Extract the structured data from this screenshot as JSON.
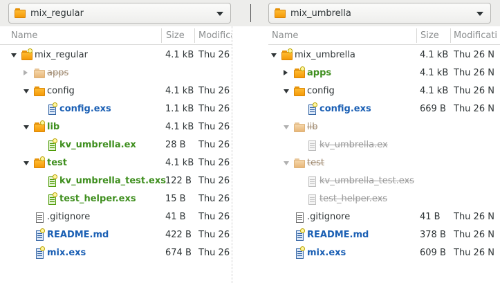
{
  "colors": {
    "modified_blue": "#1a5fb4",
    "added_green": "#3f8f1f",
    "missing_gray": "#9a9a9a",
    "folder_orange": "#f49a08"
  },
  "left": {
    "picker": {
      "label": "mix_regular",
      "icon": "folder-icon"
    },
    "columns": {
      "name": "Name",
      "size": "Size",
      "modified": "Modificati"
    },
    "rows": [
      {
        "name": "mix_regular",
        "size": "4.1 kB",
        "modified": "Thu 26",
        "icon": "folder-icon",
        "expander": "down",
        "depth": 0,
        "style": "normal"
      },
      {
        "name": "apps",
        "size": "",
        "modified": "",
        "icon": "folder-icon",
        "expander": "right",
        "depth": 1,
        "style": "ghost"
      },
      {
        "name": "config",
        "size": "4.1 kB",
        "modified": "Thu 26",
        "icon": "folder-icon",
        "expander": "down",
        "depth": 1,
        "style": "normal"
      },
      {
        "name": "config.exs",
        "size": "1.1 kB",
        "modified": "Thu 26",
        "icon": "file-icon",
        "expander": "",
        "depth": 2,
        "style": "blue"
      },
      {
        "name": "lib",
        "size": "4.1 kB",
        "modified": "Thu 26",
        "icon": "folder-icon",
        "expander": "down",
        "depth": 1,
        "style": "green"
      },
      {
        "name": "kv_umbrella.ex",
        "size": "28 B",
        "modified": "Thu 26",
        "icon": "file-icon",
        "expander": "",
        "depth": 2,
        "style": "green"
      },
      {
        "name": "test",
        "size": "4.1 kB",
        "modified": "Thu 26",
        "icon": "folder-icon",
        "expander": "down",
        "depth": 1,
        "style": "green"
      },
      {
        "name": "kv_umbrella_test.exs",
        "size": "122 B",
        "modified": "Thu 26",
        "icon": "file-icon",
        "expander": "",
        "depth": 2,
        "style": "green"
      },
      {
        "name": "test_helper.exs",
        "size": "15 B",
        "modified": "Thu 26",
        "icon": "file-icon",
        "expander": "",
        "depth": 2,
        "style": "green"
      },
      {
        "name": ".gitignore",
        "size": "41 B",
        "modified": "Thu 26",
        "icon": "file-icon",
        "expander": "",
        "depth": 1,
        "style": "normal"
      },
      {
        "name": "README.md",
        "size": "422 B",
        "modified": "Thu 26",
        "icon": "file-icon",
        "expander": "",
        "depth": 1,
        "style": "blue"
      },
      {
        "name": "mix.exs",
        "size": "674 B",
        "modified": "Thu 26",
        "icon": "file-icon",
        "expander": "",
        "depth": 1,
        "style": "blue"
      }
    ]
  },
  "right": {
    "picker": {
      "label": "mix_umbrella",
      "icon": "folder-icon"
    },
    "columns": {
      "name": "Name",
      "size": "Size",
      "modified": "Modificati"
    },
    "rows": [
      {
        "name": "mix_umbrella",
        "size": "4.1 kB",
        "modified": "Thu 26 N",
        "icon": "folder-icon",
        "expander": "down",
        "depth": 0,
        "style": "normal"
      },
      {
        "name": "apps",
        "size": "4.1 kB",
        "modified": "Thu 26 N",
        "icon": "folder-icon",
        "expander": "right",
        "depth": 1,
        "style": "green"
      },
      {
        "name": "config",
        "size": "4.1 kB",
        "modified": "Thu 26 N",
        "icon": "folder-icon",
        "expander": "down",
        "depth": 1,
        "style": "normal"
      },
      {
        "name": "config.exs",
        "size": "669 B",
        "modified": "Thu 26 N",
        "icon": "file-icon",
        "expander": "",
        "depth": 2,
        "style": "blue"
      },
      {
        "name": "lib",
        "size": "",
        "modified": "",
        "icon": "folder-icon",
        "expander": "down",
        "depth": 1,
        "style": "ghost"
      },
      {
        "name": "kv_umbrella.ex",
        "size": "",
        "modified": "",
        "icon": "file-icon",
        "expander": "",
        "depth": 2,
        "style": "ghost"
      },
      {
        "name": "test",
        "size": "",
        "modified": "",
        "icon": "folder-icon",
        "expander": "down",
        "depth": 1,
        "style": "ghost"
      },
      {
        "name": "kv_umbrella_test.exs",
        "size": "",
        "modified": "",
        "icon": "file-icon",
        "expander": "",
        "depth": 2,
        "style": "ghost"
      },
      {
        "name": "test_helper.exs",
        "size": "",
        "modified": "",
        "icon": "file-icon",
        "expander": "",
        "depth": 2,
        "style": "ghost"
      },
      {
        "name": ".gitignore",
        "size": "41 B",
        "modified": "Thu 26 N",
        "icon": "file-icon",
        "expander": "",
        "depth": 1,
        "style": "normal"
      },
      {
        "name": "README.md",
        "size": "378 B",
        "modified": "Thu 26 N",
        "icon": "file-icon",
        "expander": "",
        "depth": 1,
        "style": "blue"
      },
      {
        "name": "mix.exs",
        "size": "609 B",
        "modified": "Thu 26 N",
        "icon": "file-icon",
        "expander": "",
        "depth": 1,
        "style": "blue"
      }
    ]
  }
}
